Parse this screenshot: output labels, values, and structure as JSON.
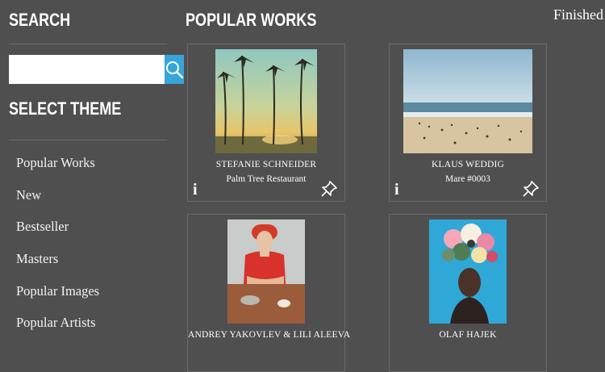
{
  "sidebar": {
    "search_heading": "Search",
    "search_placeholder": "",
    "theme_heading": "Select Theme",
    "themes": [
      "Popular Works",
      "New",
      "Bestseller",
      "Masters",
      "Popular Images",
      "Popular Artists"
    ]
  },
  "header": {
    "title": "Popular Works",
    "finished_label": "Finished"
  },
  "works": [
    {
      "artist": "STEFANIE SCHNEIDER",
      "title": "Palm Tree Restaurant"
    },
    {
      "artist": "KLAUS WEDDIG",
      "title": "Mare #0003"
    },
    {
      "artist": "ANDREY YAKOVLEV & LILI ALEEVA",
      "title": ""
    },
    {
      "artist": "OLAF HAJEK",
      "title": ""
    }
  ],
  "colors": {
    "background": "#4f4f4f",
    "accent": "#38a5d9",
    "divider": "#6a6a6a"
  },
  "icons": {
    "search": "search-icon",
    "info": "info-icon",
    "pin": "pin-icon"
  }
}
